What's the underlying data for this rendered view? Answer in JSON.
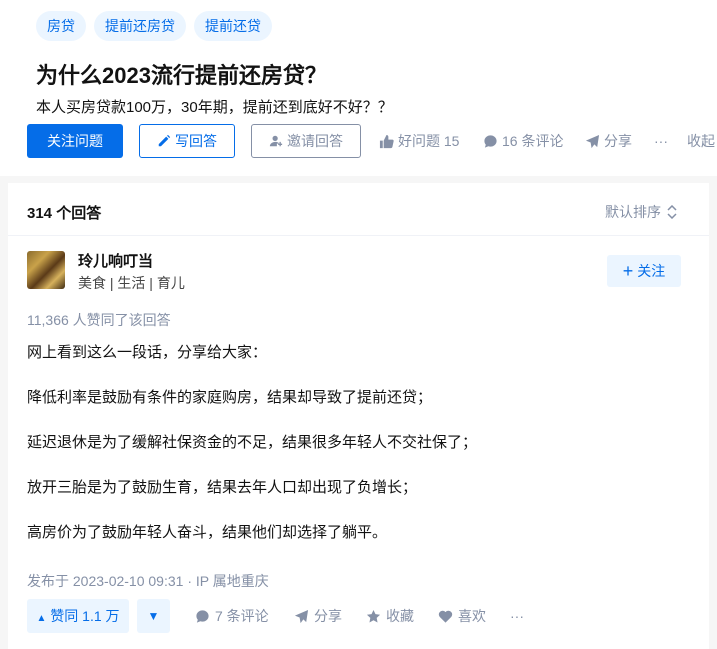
{
  "topics": [
    "房贷",
    "提前还房贷",
    "提前还贷"
  ],
  "question": {
    "title": "为什么2023流行提前还房贷？",
    "description": "本人买房贷款100万，30年期，提前还到底好不好？？"
  },
  "actions": {
    "follow_label": "关注问题",
    "write_label": "写回答",
    "invite_label": "邀请回答",
    "good_question": "好问题 15",
    "comments": "16 条评论",
    "share": "分享",
    "more": "···",
    "collapse": "收起"
  },
  "answers": {
    "count": "314 个回答",
    "sort_label": "默认排序"
  },
  "answer": {
    "author_name": "玲儿响叮当",
    "author_tags": "美食 | 生活 | 育儿",
    "follow_label": "关注",
    "approvers": "11,366 人赞同了该回答",
    "paragraphs": [
      "网上看到这么一段话，分享给大家：",
      "降低利率是鼓励有条件的家庭购房，结果却导致了提前还贷；",
      "延迟退休是为了缓解社保资金的不足，结果很多年轻人不交社保了；",
      "放开三胎是为了鼓励生育，结果去年人口却出现了负增长；",
      "高房价为了鼓励年轻人奋斗，结果他们却选择了躺平。"
    ],
    "published": "发布于 2023-02-10 09:31 · IP 属地重庆",
    "vote_label": "赞同 1.1 万",
    "vote_down": "▼",
    "comments": "7 条评论",
    "share": "分享",
    "collect": "收藏",
    "like": "喜欢",
    "more": "···"
  },
  "colors": {
    "brand": "#056de8",
    "brand_light": "#ebf5ff",
    "muted": "#8590a6"
  }
}
